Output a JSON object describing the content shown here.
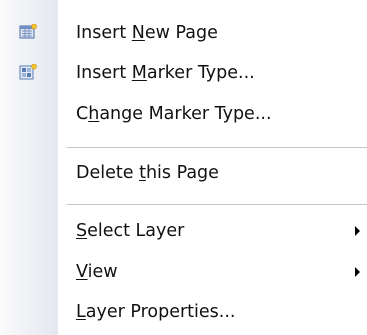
{
  "menu": {
    "items": [
      {
        "id": "insert-new-page",
        "icon": "insert-page-icon",
        "pre": "Insert ",
        "mn": "N",
        "post": "ew Page"
      },
      {
        "id": "insert-marker-type",
        "icon": "insert-marker-icon",
        "pre": "Insert ",
        "mn": "M",
        "post": "arker Type..."
      },
      {
        "id": "change-marker-type",
        "pre": "C",
        "mn": "h",
        "post": "ange Marker Type..."
      },
      {
        "id": "delete-this-page",
        "pre": "Delete ",
        "mn": "t",
        "post": "his Page"
      },
      {
        "id": "select-layer",
        "pre": "",
        "mn": "S",
        "post": "elect Layer",
        "submenu": true
      },
      {
        "id": "view",
        "pre": "",
        "mn": "V",
        "post": "iew",
        "submenu": true
      },
      {
        "id": "layer-properties",
        "pre": "",
        "mn": "L",
        "post": "ayer Properties..."
      }
    ]
  }
}
